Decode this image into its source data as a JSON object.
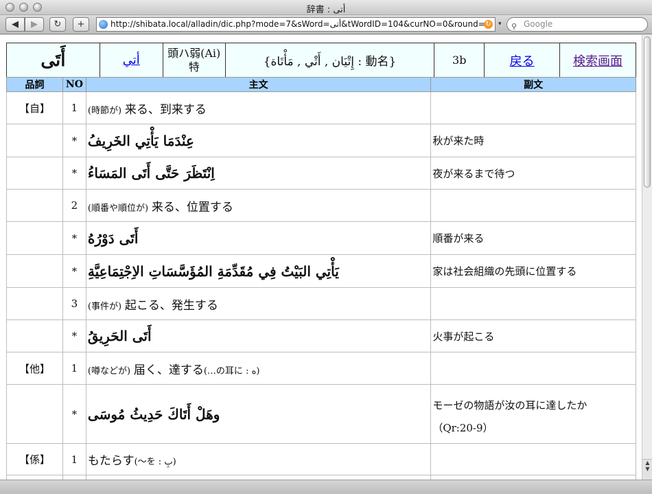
{
  "window": {
    "title": "辞書 : أتى"
  },
  "toolbar": {
    "back": "◀",
    "forward": "▶",
    "reload": "↻",
    "add": "+",
    "url": "http://shibata.local/alladin/dic.php?mode=7&sWord=أتى&tWordID=104&curNO=0&round=1",
    "search_placeholder": "Google"
  },
  "header": {
    "word": "أَتَى",
    "root": "أتي",
    "class": "頭ハ弱(Ai)特",
    "forms": "{إِتْيَان , أَتْي , مَأْتَاة : 動名}",
    "type": "3b",
    "back_link": "戻る",
    "search_link": "検索画面"
  },
  "columns": {
    "pos": "品詞",
    "no": "NO",
    "main": "主文",
    "sub": "副文"
  },
  "rows": [
    {
      "pos": "【自】",
      "no": "1",
      "note": "(時節が)",
      "main": "来る、到来する",
      "arabic": "",
      "sub": "",
      "sub2": ""
    },
    {
      "pos": "",
      "no": "*",
      "note": "",
      "main": "",
      "arabic": "عِنْدَمَا يَأْتِي الخَرِيفُ",
      "sub": "秋が来た時",
      "sub2": ""
    },
    {
      "pos": "",
      "no": "*",
      "note": "",
      "main": "",
      "arabic": "اِنْتَظَرَ حَتَّى أَتَى المَسَاءُ",
      "sub": "夜が来るまで待つ",
      "sub2": ""
    },
    {
      "pos": "",
      "no": "2",
      "note": "(順番や順位が)",
      "main": "来る、位置する",
      "arabic": "",
      "sub": "",
      "sub2": ""
    },
    {
      "pos": "",
      "no": "*",
      "note": "",
      "main": "",
      "arabic": "أَتَى دَوْرُهُ",
      "sub": "順番が来る",
      "sub2": ""
    },
    {
      "pos": "",
      "no": "*",
      "note": "",
      "main": "",
      "arabic": "يَأْتِي البَيْتُ فِي مُقَدِّمَةِ المُؤَسَّسَاتِ الاِجْتِمَاعِيَّةِ",
      "sub": "家は社会組織の先頭に位置する",
      "sub2": ""
    },
    {
      "pos": "",
      "no": "3",
      "note": "(事件が)",
      "main": "起こる、発生する",
      "arabic": "",
      "sub": "",
      "sub2": ""
    },
    {
      "pos": "",
      "no": "*",
      "note": "",
      "main": "",
      "arabic": "أَتَى الحَرِيقُ",
      "sub": "火事が起こる",
      "sub2": ""
    },
    {
      "pos": "【他】",
      "no": "1",
      "note": "(噂などが)",
      "main": "届く、達する",
      "extra": "(…の耳に : ه)",
      "arabic": "",
      "sub": "",
      "sub2": ""
    },
    {
      "pos": "",
      "no": "*",
      "note": "",
      "main": "",
      "arabic": "وهَلْ أَتَاكَ حَدِيثُ مُوسَى",
      "sub": "モーゼの物語が汝の耳に達したか",
      "sub2": "（Qr:20-9）"
    },
    {
      "pos": "【係】",
      "no": "1",
      "note": "",
      "main": "もたらす",
      "extra": "(〜を : بِ)",
      "arabic": "",
      "sub": "",
      "sub2": ""
    }
  ]
}
